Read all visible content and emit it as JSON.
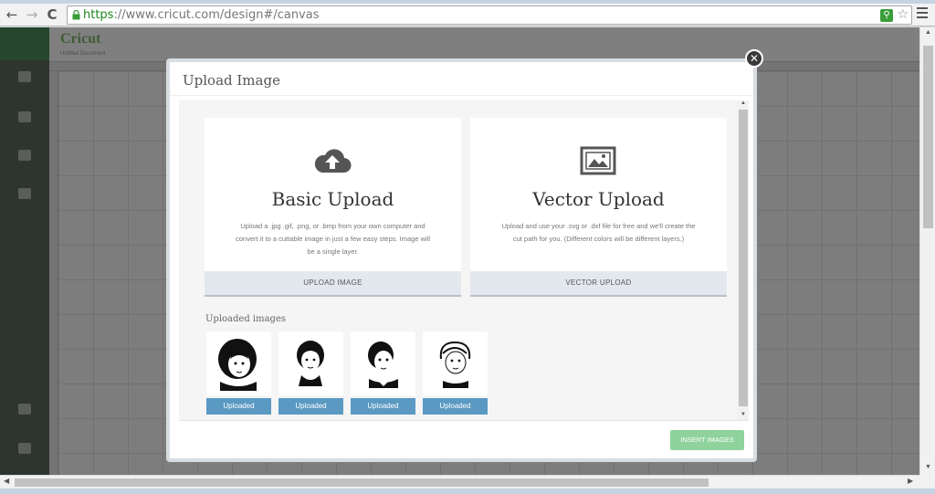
{
  "browser": {
    "url_scheme": "https",
    "url_rest": "://www.cricut.com/design#/canvas",
    "nav": {
      "back": "←",
      "forward": "→",
      "reload": "C"
    }
  },
  "app": {
    "logo": "Cricut",
    "doc_name": "Untitled Document"
  },
  "modal": {
    "title": "Upload Image",
    "close_glyph": "✕",
    "cards": [
      {
        "title": "Basic Upload",
        "description": "Upload a .jpg .gif, .png, or .bmp from your own computer and convert it to a cuttable image in just a few easy steps. Image will be a single layer.",
        "button": "UPLOAD IMAGE",
        "icon": "cloud-upload-icon"
      },
      {
        "title": "Vector Upload",
        "description": "Upload and use your .svg or .dxf file for free and we'll create the cut path for you. (Different colors will be different layers.)",
        "button": "VECTOR UPLOAD",
        "icon": "image-icon"
      }
    ],
    "uploaded_label": "Uploaded images",
    "uploaded_items": [
      {
        "button": "Uploaded"
      },
      {
        "button": "Uploaded"
      },
      {
        "button": "Uploaded"
      },
      {
        "button": "Uploaded"
      }
    ],
    "insert_button": "INSERT IMAGES"
  },
  "colors": {
    "uploaded_button": "#5a99c2",
    "insert_button": "#8fd29c",
    "url_https": "#1a8a1a"
  }
}
